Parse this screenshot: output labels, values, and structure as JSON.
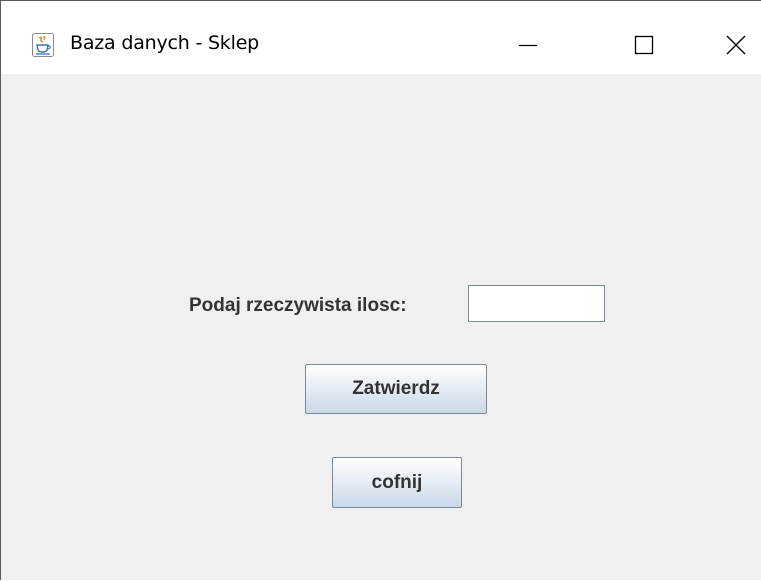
{
  "window": {
    "title": "Baza danych - Sklep",
    "app_icon": "java-coffee-cup-icon",
    "controls": {
      "minimize_icon": "minimize-icon",
      "maximize_icon": "maximize-icon",
      "close_icon": "close-icon"
    }
  },
  "form": {
    "quantity_label": "Podaj rzeczywista ilosc:",
    "quantity_value": "",
    "confirm_label": "Zatwierdz",
    "back_label": "cofnij"
  },
  "colors": {
    "background": "#f0f0f0",
    "titlebar": "#ffffff",
    "button_border": "#7a8a99",
    "text": "#333333"
  }
}
